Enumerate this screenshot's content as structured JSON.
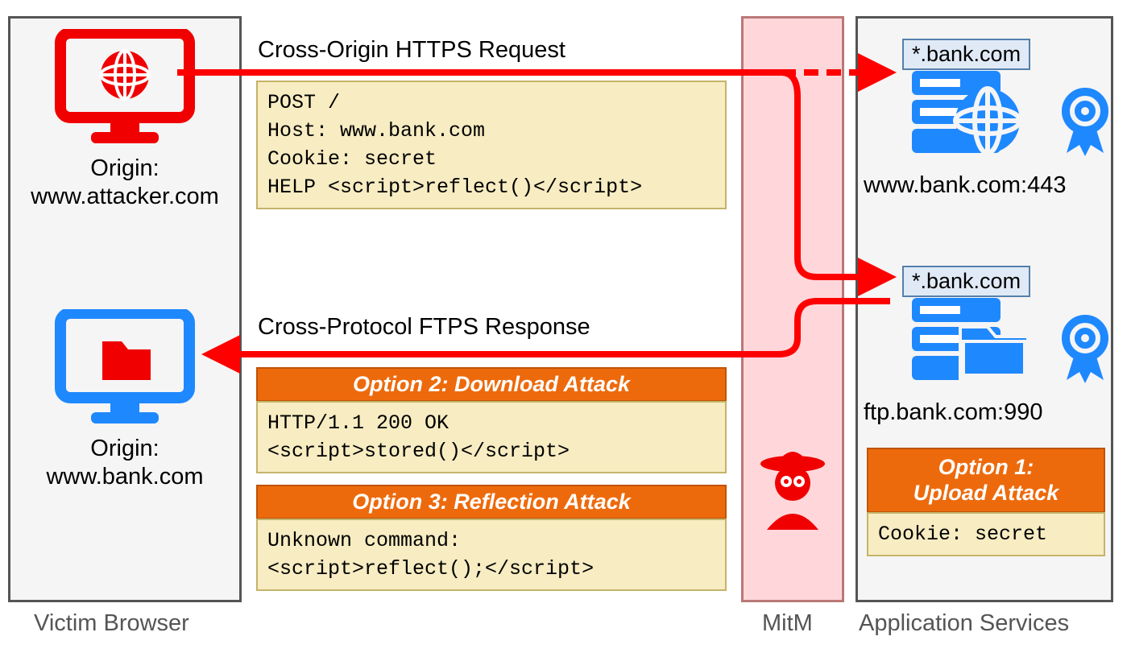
{
  "captions": {
    "victim": "Victim Browser",
    "mitm": "MitM",
    "app": "Application Services"
  },
  "victim": {
    "origin1_label": "Origin:",
    "origin1_value": "www.attacker.com",
    "origin2_label": "Origin:",
    "origin2_value": "www.bank.com"
  },
  "request": {
    "title": "Cross-Origin HTTPS Request",
    "body": "POST /\nHost: www.bank.com\nCookie: secret\nHELP <script>reflect()</script>"
  },
  "response": {
    "title": "Cross-Protocol FTPS Response"
  },
  "option2": {
    "header": "Option 2: Download Attack",
    "body": "HTTP/1.1 200 OK\n<script>stored()</script>"
  },
  "option3": {
    "header": "Option 3: Reflection Attack",
    "body": "Unknown command:\n<script>reflect();</script>"
  },
  "option1": {
    "header": "Option 1:\nUpload Attack",
    "body": "Cookie: secret"
  },
  "services": {
    "cert": "*.bank.com",
    "www_label": "www.bank.com:443",
    "ftp_label": "ftp.bank.com:990"
  },
  "colors": {
    "red": "#f00000",
    "blue": "#1e88ff",
    "orange": "#ed6a0c",
    "cream": "#f7ecc2"
  }
}
